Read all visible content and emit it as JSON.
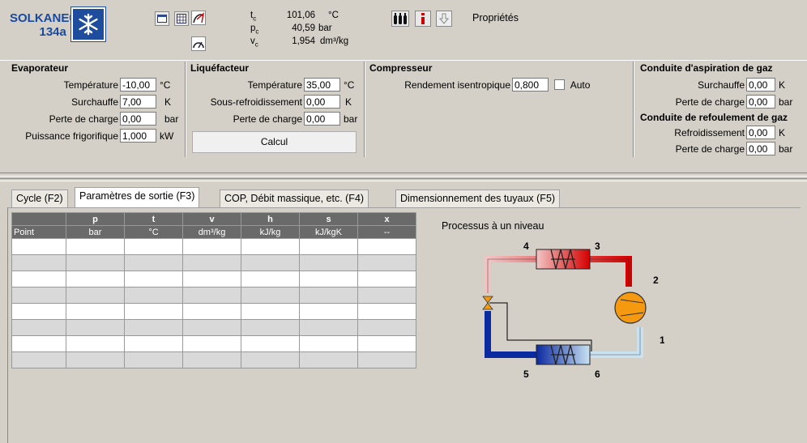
{
  "logo": {
    "brand": "SOLKANE®",
    "refrigerant": "134a"
  },
  "critical": {
    "tc_symbol": "t",
    "tc_sub": "c",
    "tc_value": "101,06",
    "tc_unit": "°C",
    "pc_symbol": "p",
    "pc_sub": "c",
    "pc_value": "40,59",
    "pc_unit": "bar",
    "vc_symbol": "v",
    "vc_sub": "c",
    "vc_value": "1,954",
    "vc_unit": "dm³/kg"
  },
  "toolbar": {
    "properties_label": "Propriétés"
  },
  "evaporator": {
    "title": "Evaporateur",
    "temperature_label": "Température",
    "temperature_value": "-10,00",
    "temperature_unit": "°C",
    "superheat_label": "Surchauffe",
    "superheat_value": "7,00",
    "superheat_unit": "K",
    "pressure_drop_label": "Perte de charge",
    "pressure_drop_value": "0,00",
    "pressure_drop_unit": "bar",
    "power_label": "Puissance frigorifique",
    "power_value": "1,000",
    "power_unit": "kW"
  },
  "condenser": {
    "title": "Liquéfacteur",
    "temperature_label": "Température",
    "temperature_value": "35,00",
    "temperature_unit": "°C",
    "subcooling_label": "Sous-refroidissement",
    "subcooling_value": "0,00",
    "subcooling_unit": "K",
    "pressure_drop_label": "Perte de charge",
    "pressure_drop_value": "0,00",
    "pressure_drop_unit": "bar",
    "calc_button": "Calcul"
  },
  "compressor": {
    "title": "Compresseur",
    "efficiency_label": "Rendement isentropique",
    "efficiency_value": "0,800",
    "auto_label": "Auto"
  },
  "suction_line": {
    "title": "Conduite d'aspiration de gaz",
    "superheat_label": "Surchauffe",
    "superheat_value": "0,00",
    "superheat_unit": "K",
    "pressure_drop_label": "Perte de charge",
    "pressure_drop_value": "0,00",
    "pressure_drop_unit": "bar"
  },
  "discharge_line": {
    "title": "Conduite de refoulement de gaz",
    "cooling_label": "Refroidissement",
    "cooling_value": "0,00",
    "cooling_unit": "K",
    "pressure_drop_label": "Perte de charge",
    "pressure_drop_value": "0,00",
    "pressure_drop_unit": "bar"
  },
  "tabs": [
    {
      "label": "Cycle (F2)"
    },
    {
      "label": "Paramètres de sortie (F3)"
    },
    {
      "label": "COP, Débit massique, etc. (F4)"
    },
    {
      "label": "Dimensionnement des tuyaux (F5)"
    }
  ],
  "table": {
    "headers": [
      "",
      "p",
      "t",
      "v",
      "h",
      "s",
      "x"
    ],
    "units": [
      "Point",
      "bar",
      "°C",
      "dm³/kg",
      "kJ/kg",
      "kJ/kgK",
      "--"
    ],
    "row_count": 8
  },
  "diagram": {
    "title": "Processus à un niveau",
    "labels": [
      "1",
      "2",
      "3",
      "4",
      "5",
      "6"
    ]
  }
}
